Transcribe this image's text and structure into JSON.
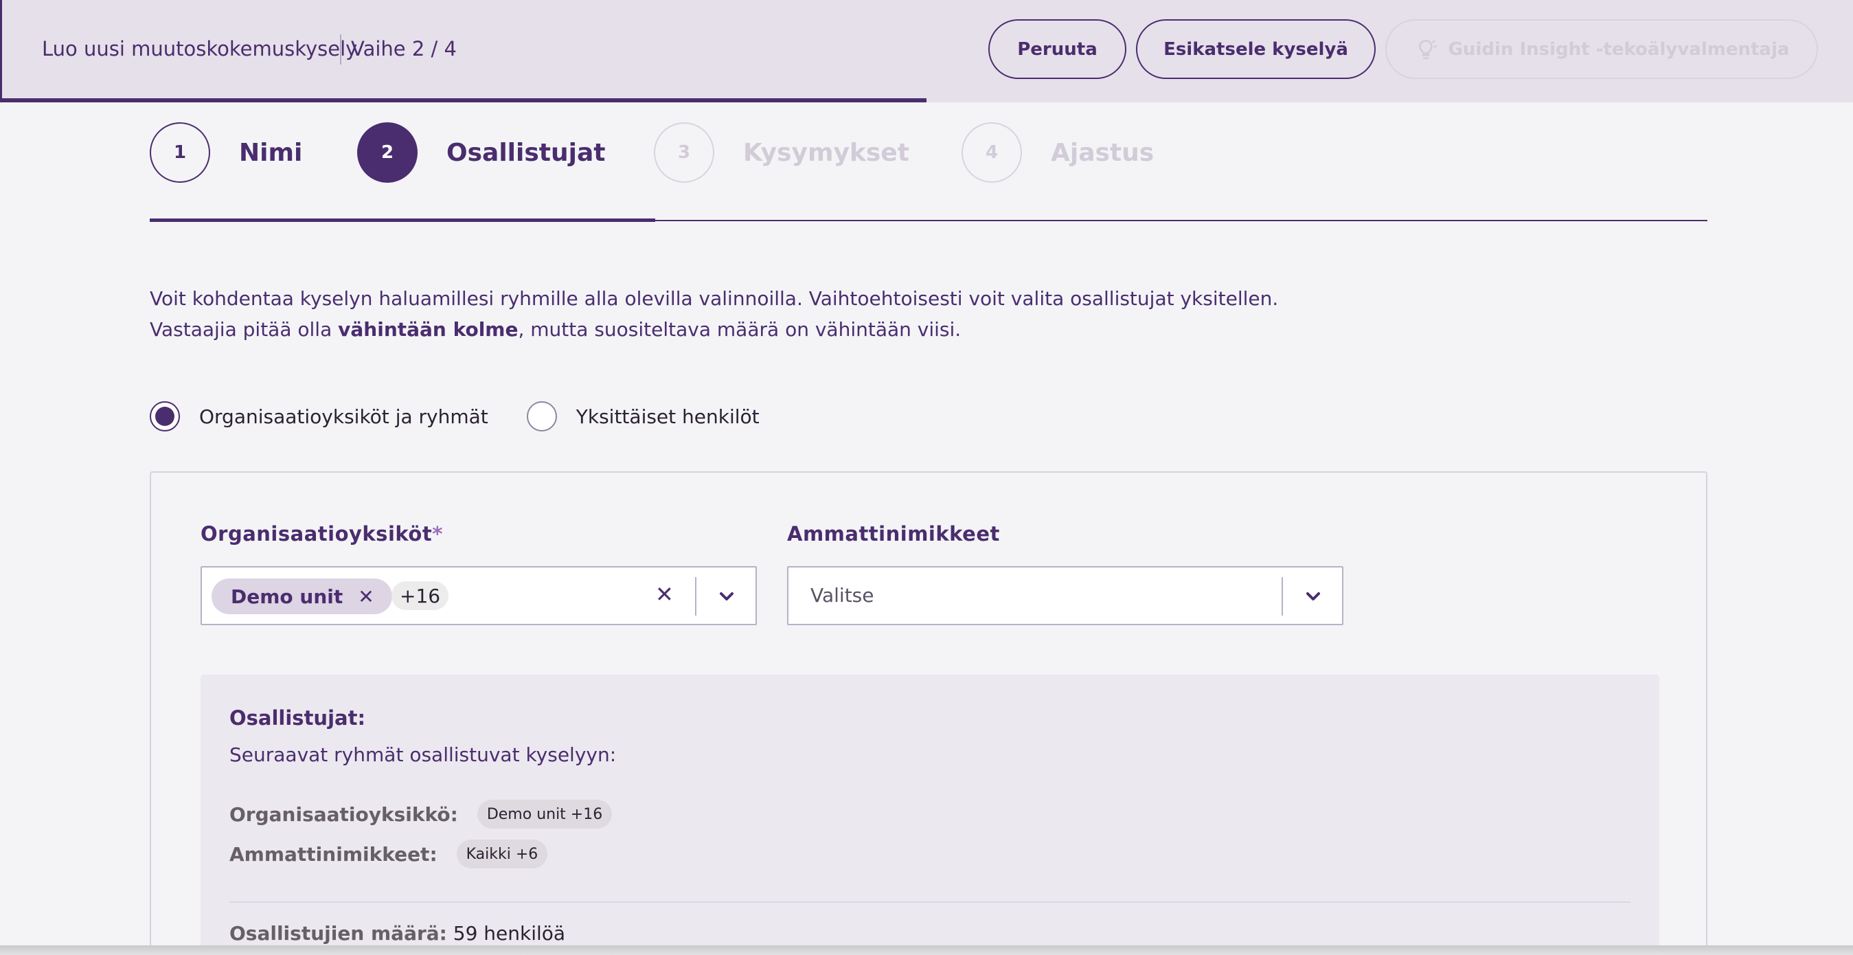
{
  "header": {
    "title": "Luo uusi muutoskokemuskysely",
    "step": "Vaihe 2 / 4",
    "cancel_label": "Peruuta",
    "preview_label": "Esikatsele kyselyä",
    "ai_label": "Guidin Insight -tekoälyvalmentaja",
    "ai_icon": "lightbulb-icon",
    "progress": 0.5
  },
  "stepper": {
    "steps": [
      {
        "number": "1",
        "label": "Nimi",
        "state": "completed"
      },
      {
        "number": "2",
        "label": "Osallistujat",
        "state": "active"
      },
      {
        "number": "3",
        "label": "Kysymykset",
        "state": "disabled"
      },
      {
        "number": "4",
        "label": "Ajastus",
        "state": "disabled"
      }
    ]
  },
  "intro": {
    "line1": "Voit kohdentaa kyselyn haluamillesi ryhmille alla olevilla valinnoilla. Vaihtoehtoisesti voit valita osallistujat yksitellen.",
    "line2_prefix": "Vastaajia pitää olla ",
    "line2_bold": "vähintään kolme",
    "line2_suffix": ", mutta suositeltava määrä on vähintään viisi."
  },
  "targeting": {
    "options": [
      {
        "label": "Organisaatioyksiköt ja ryhmät",
        "checked": true
      },
      {
        "label": "Yksittäiset henkilöt",
        "checked": false
      }
    ]
  },
  "filters": {
    "org_label": "Organisaatioyksiköt",
    "org_required": "*",
    "org_chip": "Demo unit",
    "org_more": "+16",
    "job_label": "Ammattinimikkeet",
    "job_placeholder": "Valitse"
  },
  "participants": {
    "title": "Osallistujat:",
    "subtitle": "Seuraavat ryhmät osallistuvat kyselyyn:",
    "org_key": "Organisaatioyksikkö:",
    "org_value": "Demo unit +16",
    "job_key": "Ammattinimikkeet:",
    "job_value": "Kaikki +6",
    "count_key": "Osallistujien määrä:",
    "count_value": "59 henkilöä"
  },
  "colors": {
    "brand": "#4a2d6e",
    "header_bg": "#e6e0ea",
    "page_bg": "#f4f4f7",
    "chip_bg": "#ddd4e4",
    "disabled": "#d2cbd8"
  }
}
